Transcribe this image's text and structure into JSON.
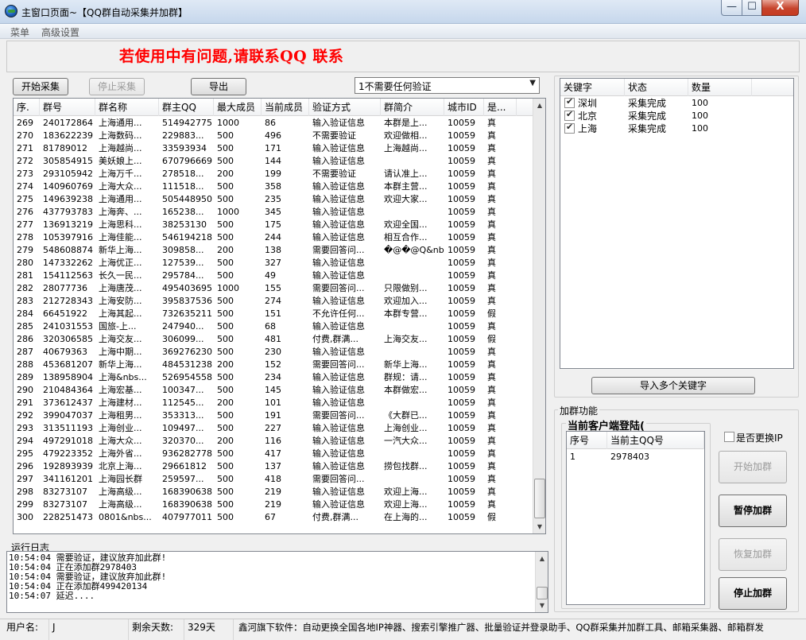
{
  "window": {
    "title": "主窗口页面~【QQ群自动采集并加群】",
    "min_glyph": "—",
    "max_glyph": "☐",
    "close_glyph": "X"
  },
  "menu": [
    "菜单",
    "高级设置"
  ],
  "banner": "若使用中有问题,请联系QQ 联系",
  "toolbar": {
    "start_label": "开始采集",
    "stop_label": "停止采集",
    "export_label": "导出",
    "verify_select": "1不需要任何验证",
    "dropdown_arrow": "▼"
  },
  "group_table": {
    "columns": [
      "序.",
      "群号",
      "群名称",
      "群主QQ",
      "最大成员",
      "当前成员",
      "验证方式",
      "群简介",
      "城市ID",
      "是..."
    ],
    "rows": [
      [
        "269",
        "240172864",
        "上海通用...",
        "514942775",
        "1000",
        "86",
        "输入验证信息",
        "本群是上...",
        "10059",
        "真"
      ],
      [
        "270",
        "183622239",
        "上海数码...",
        "229883...",
        "500",
        "496",
        "不需要验证",
        "欢迎做相...",
        "10059",
        "真"
      ],
      [
        "271",
        "81789012",
        "上海越尚...",
        "33593934",
        "500",
        "171",
        "输入验证信息",
        "上海越尚...",
        "10059",
        "真"
      ],
      [
        "272",
        "305854915",
        "美妖娘上...",
        "670796669",
        "500",
        "144",
        "输入验证信息",
        "",
        "10059",
        "真"
      ],
      [
        "273",
        "293105942",
        "上海万千...",
        "278518...",
        "200",
        "199",
        "不需要验证",
        "请认准上...",
        "10059",
        "真"
      ],
      [
        "274",
        "140960769",
        "上海大众...",
        "111518...",
        "500",
        "358",
        "输入验证信息",
        "本群主营...",
        "10059",
        "真"
      ],
      [
        "275",
        "149639238",
        "上海通用...",
        "505448950",
        "500",
        "235",
        "输入验证信息",
        "欢迎大家...",
        "10059",
        "真"
      ],
      [
        "276",
        "437793783",
        "上海奔、...",
        "165238...",
        "1000",
        "345",
        "输入验证信息",
        "",
        "10059",
        "真"
      ],
      [
        "277",
        "136913219",
        "上海思科...",
        "38253130",
        "500",
        "175",
        "输入验证信息",
        "欢迎全国...",
        "10059",
        "真"
      ],
      [
        "278",
        "105397916",
        "上海佳能...",
        "546194218",
        "500",
        "244",
        "输入验证信息",
        "相互合作...",
        "10059",
        "真"
      ],
      [
        "279",
        "548608874",
        "新华上海...",
        "309858...",
        "200",
        "138",
        "需要回答问...",
        "�@�@Q&nb...",
        "10059",
        "真"
      ],
      [
        "280",
        "147332262",
        "上海优正...",
        "127539...",
        "500",
        "327",
        "输入验证信息",
        "",
        "10059",
        "真"
      ],
      [
        "281",
        "154112563",
        "长久一民...",
        "295784...",
        "500",
        "49",
        "输入验证信息",
        "",
        "10059",
        "真"
      ],
      [
        "282",
        "28077736",
        "上海唐茂...",
        "495403695",
        "1000",
        "155",
        "需要回答问...",
        "只限做别...",
        "10059",
        "真"
      ],
      [
        "283",
        "212728343",
        "上海安防...",
        "395837536",
        "500",
        "274",
        "输入验证信息",
        "欢迎加入...",
        "10059",
        "真"
      ],
      [
        "284",
        "66451922",
        "上海其起...",
        "732635211",
        "500",
        "151",
        "不允许任何...",
        "本群专营...",
        "10059",
        "假"
      ],
      [
        "285",
        "241031553",
        "国旅-上...",
        "247940...",
        "500",
        "68",
        "输入验证信息",
        "",
        "10059",
        "真"
      ],
      [
        "286",
        "320306585",
        "上海交友...",
        "306099...",
        "500",
        "481",
        "付费,群满...",
        "上海交友...",
        "10059",
        "假"
      ],
      [
        "287",
        "40679363",
        "上海中期...",
        "369276230",
        "500",
        "230",
        "输入验证信息",
        "",
        "10059",
        "真"
      ],
      [
        "288",
        "453681207",
        "新华上海...",
        "484531238",
        "200",
        "152",
        "需要回答问...",
        "新华上海...",
        "10059",
        "真"
      ],
      [
        "289",
        "138958904",
        "上海&nbs...",
        "526954558",
        "500",
        "234",
        "输入验证信息",
        "群规：请...",
        "10059",
        "真"
      ],
      [
        "290",
        "210484364",
        "上海宏基...",
        "100347...",
        "500",
        "145",
        "输入验证信息",
        "本群做宏...",
        "10059",
        "真"
      ],
      [
        "291",
        "373612437",
        "上海建材...",
        "112545...",
        "200",
        "101",
        "输入验证信息",
        "",
        "10059",
        "真"
      ],
      [
        "292",
        "399047037",
        "上海租男...",
        "353313...",
        "500",
        "191",
        "需要回答问...",
        "《大群已...",
        "10059",
        "真"
      ],
      [
        "293",
        "313511193",
        "上海创业...",
        "109497...",
        "500",
        "227",
        "输入验证信息",
        "上海创业...",
        "10059",
        "真"
      ],
      [
        "294",
        "497291018",
        "上海大众...",
        "320370...",
        "200",
        "116",
        "输入验证信息",
        "一汽大众...",
        "10059",
        "真"
      ],
      [
        "295",
        "479223352",
        "上海外省...",
        "936282778",
        "500",
        "417",
        "输入验证信息",
        "",
        "10059",
        "真"
      ],
      [
        "296",
        "192893939",
        "北京上海...",
        "29661812",
        "500",
        "137",
        "输入验证信息",
        "捞包找群...",
        "10059",
        "真"
      ],
      [
        "297",
        "341161201",
        "上海园长群",
        "259597...",
        "500",
        "418",
        "需要回答问...",
        "",
        "10059",
        "真"
      ],
      [
        "298",
        "83273107",
        "上海高级...",
        "168390638",
        "500",
        "219",
        "输入验证信息",
        "欢迎上海...",
        "10059",
        "真"
      ],
      [
        "299",
        "83273107",
        "上海高级...",
        "168390638",
        "500",
        "219",
        "输入验证信息",
        "欢迎上海...",
        "10059",
        "真"
      ],
      [
        "300",
        "228251473",
        "0801&nbs...",
        "407977011",
        "500",
        "67",
        "付费,群满...",
        "在上海的...",
        "10059",
        "假"
      ]
    ]
  },
  "keyword_table": {
    "columns": [
      "关键字",
      "状态",
      "数量"
    ],
    "rows": [
      {
        "keyword": "深圳",
        "status": "采集完成",
        "count": "100"
      },
      {
        "keyword": "北京",
        "status": "采集完成",
        "count": "100"
      },
      {
        "keyword": "上海",
        "status": "采集完成",
        "count": "100"
      }
    ]
  },
  "import_keywords_label": "导入多个关键字",
  "add_group": {
    "section_label": "加群功能",
    "login_label": "当前客户端登陆(",
    "columns": [
      "序号",
      "当前主QQ号"
    ],
    "rows": [
      {
        "index": "1",
        "qq": "2978403"
      }
    ],
    "change_ip_label": "是否更换IP",
    "start_label": "开始加群",
    "pause_label": "暂停加群",
    "resume_label": "恢复加群",
    "stop_label": "停止加群"
  },
  "log": {
    "label": "运行日志",
    "lines": [
      "10:54:04 需要验证，建议放弃加此群!",
      "10:54:04 正在添加群2978403",
      "10:54:04 需要验证，建议放弃加此群!",
      "10:54:04 正在添加群499420134",
      "10:54:07 延迟...."
    ]
  },
  "statusbar": {
    "user_label": "用户名:",
    "user_value": "J",
    "days_label": "剩余天数:",
    "days_value": "329天",
    "promo": "鑫河旗下软件：自动更换全国各地IP神器、搜索引擎推广器、批量验证并登录助手、QQ群采集并加群工具、邮箱采集器、邮箱群发"
  },
  "scroll_glyphs": {
    "up": "▲",
    "down": "▼"
  }
}
